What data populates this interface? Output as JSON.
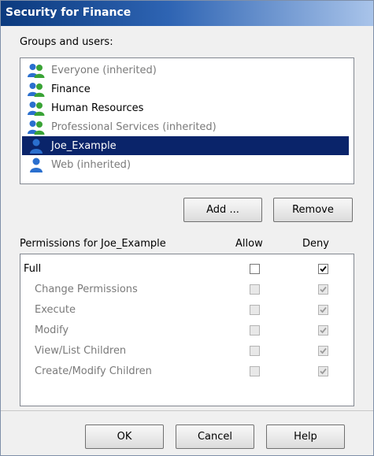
{
  "title": "Security for Finance",
  "groups_label": "Groups and users:",
  "principals": [
    {
      "name": "Everyone (inherited)",
      "icon": "group-icon",
      "inherited": true,
      "selected": false
    },
    {
      "name": "Finance",
      "icon": "group-icon",
      "inherited": false,
      "selected": false
    },
    {
      "name": "Human Resources",
      "icon": "group-icon",
      "inherited": false,
      "selected": false
    },
    {
      "name": "Professional Services (inherited)",
      "icon": "group-icon",
      "inherited": true,
      "selected": false
    },
    {
      "name": "Joe_Example",
      "icon": "user-icon",
      "inherited": false,
      "selected": true
    },
    {
      "name": "Web (inherited)",
      "icon": "user-icon",
      "inherited": true,
      "selected": false
    }
  ],
  "buttons": {
    "add": "Add ...",
    "remove": "Remove",
    "ok": "OK",
    "cancel": "Cancel",
    "help": "Help"
  },
  "permissions_header": {
    "label": "Permissions for Joe_Example",
    "allow": "Allow",
    "deny": "Deny"
  },
  "permissions": [
    {
      "name": "Full",
      "allow": false,
      "deny": true,
      "enabled": true,
      "sub": false
    },
    {
      "name": "Change Permissions",
      "allow": false,
      "deny": true,
      "enabled": false,
      "sub": true
    },
    {
      "name": "Execute",
      "allow": false,
      "deny": true,
      "enabled": false,
      "sub": true
    },
    {
      "name": "Modify",
      "allow": false,
      "deny": true,
      "enabled": false,
      "sub": true
    },
    {
      "name": "View/List Children",
      "allow": false,
      "deny": true,
      "enabled": false,
      "sub": true
    },
    {
      "name": "Create/Modify Children",
      "allow": false,
      "deny": true,
      "enabled": false,
      "sub": true
    }
  ],
  "colors": {
    "selection": "#0a246a",
    "title_bar": "#0b3a7e",
    "group_icon_green": "#3aa336",
    "user_icon_blue": "#2a6fce"
  }
}
